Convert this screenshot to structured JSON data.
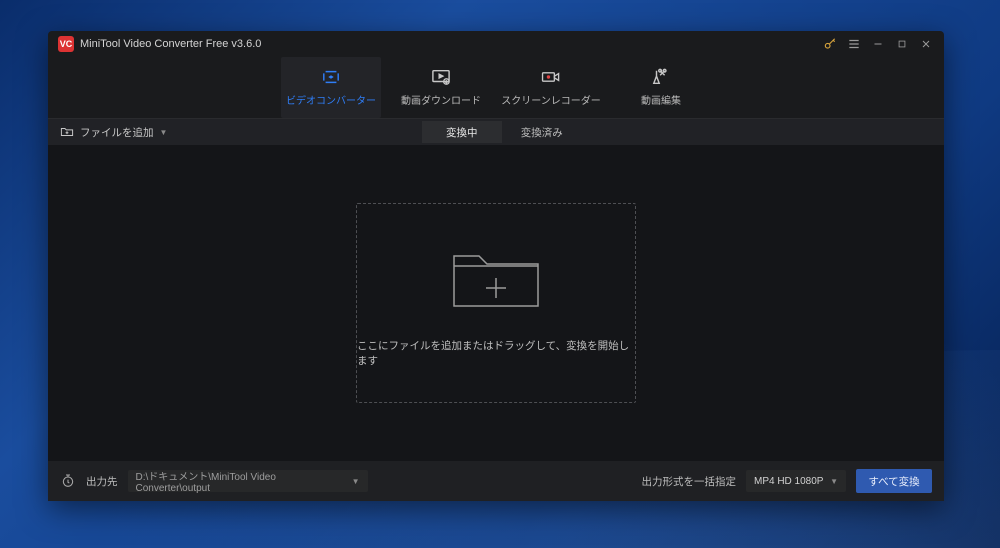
{
  "titlebar": {
    "app_title": "MiniTool Video Converter Free v3.6.0",
    "logo_text": "VC"
  },
  "nav": {
    "items": [
      {
        "label": "ビデオコンバーター"
      },
      {
        "label": "動画ダウンロード"
      },
      {
        "label": "スクリーンレコーダー"
      },
      {
        "label": "動画編集"
      }
    ]
  },
  "subbar": {
    "add_file_label": "ファイルを追加",
    "tabs": [
      {
        "label": "変換中"
      },
      {
        "label": "変換済み"
      }
    ]
  },
  "dropzone": {
    "hint": "ここにファイルを追加またはドラッグして、変換を開始します"
  },
  "footer": {
    "output_label": "出力先",
    "output_path": "D:\\ドキュメント\\MiniTool Video Converter\\output",
    "format_label": "出力形式を一括指定",
    "format_value": "MP4 HD 1080P",
    "convert_label": "すべて変換"
  }
}
